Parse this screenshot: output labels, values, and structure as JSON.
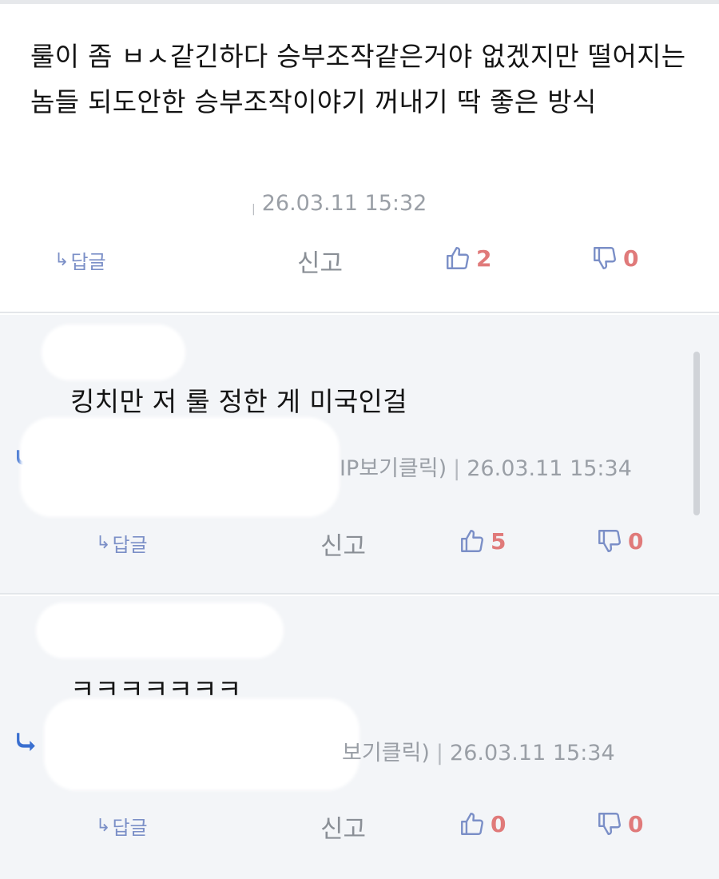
{
  "comments": [
    {
      "text": "룰이 좀 ㅂㅅ같긴하다 승부조작같은거야 없겠지만 떨어지는 놈들 되도안한 승부조작이야기 꺼내기 딱 좋은 방식",
      "meta_sep": "|",
      "timestamp": "26.03.11 15:32",
      "reply_label": "답글",
      "report_label": "신고",
      "likes": "2",
      "dislikes": "0"
    },
    {
      "text": "킹치만 저 룰 정한 게 미국인걸",
      "ip_label": "IP보기클릭)",
      "meta_sep": "|",
      "timestamp": "26.03.11 15:34",
      "reply_label": "답글",
      "report_label": "신고",
      "likes": "5",
      "dislikes": "0"
    },
    {
      "text": "ㅋㅋㅋㅋㅋㅋㅋ",
      "ip_label": "보기클릭)",
      "meta_sep": "|",
      "timestamp": "26.03.11 15:34",
      "reply_label": "답글",
      "report_label": "신고",
      "likes": "0",
      "dislikes": "0"
    }
  ],
  "colors": {
    "like_icon": "#7b8fc7",
    "count": "#e07a7a",
    "reply_arrow": "#3a6fd0",
    "meta": "#9a9fa6"
  }
}
